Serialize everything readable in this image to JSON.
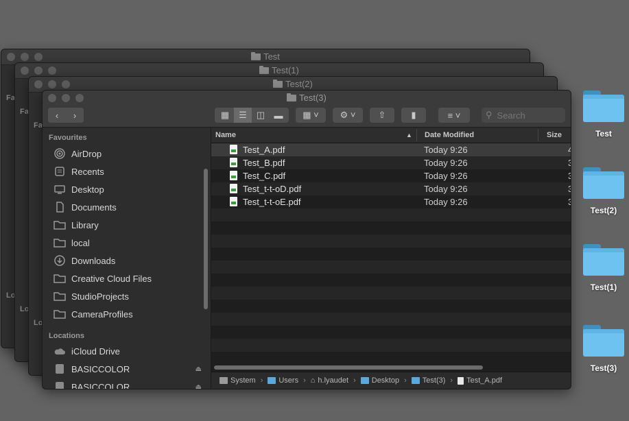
{
  "windows": [
    {
      "title": "Test"
    },
    {
      "title": "Test(1)"
    },
    {
      "title": "Test(2)"
    },
    {
      "title": "Test(3)"
    }
  ],
  "back_labels": {
    "favourites_short": "Fa",
    "locations_short": "Lo"
  },
  "toolbar": {
    "search_placeholder": "Search"
  },
  "sidebar": {
    "favourites_header": "Favourites",
    "favourites": [
      {
        "label": "AirDrop",
        "icon": "airdrop-icon"
      },
      {
        "label": "Recents",
        "icon": "recents-icon"
      },
      {
        "label": "Desktop",
        "icon": "desktop-icon"
      },
      {
        "label": "Documents",
        "icon": "documents-icon"
      },
      {
        "label": "Library",
        "icon": "folder-icon"
      },
      {
        "label": "local",
        "icon": "folder-icon"
      },
      {
        "label": "Downloads",
        "icon": "downloads-icon"
      },
      {
        "label": "Creative Cloud Files",
        "icon": "folder-icon"
      },
      {
        "label": "StudioProjects",
        "icon": "folder-icon"
      },
      {
        "label": "CameraProfiles",
        "icon": "folder-icon"
      }
    ],
    "locations_header": "Locations",
    "locations": [
      {
        "label": "iCloud Drive",
        "icon": "icloud-icon"
      },
      {
        "label": "BASICCOLOR",
        "icon": "disk-icon"
      },
      {
        "label": "BASICCOLOR",
        "icon": "disk-icon"
      }
    ]
  },
  "columns": {
    "name": "Name",
    "date": "Date Modified",
    "size": "Size"
  },
  "files": [
    {
      "name": "Test_A.pdf",
      "date": "Today 9:26",
      "size": "4"
    },
    {
      "name": "Test_B.pdf",
      "date": "Today 9:26",
      "size": "3"
    },
    {
      "name": "Test_C.pdf",
      "date": "Today 9:26",
      "size": "3"
    },
    {
      "name": "Test_t-t-oD.pdf",
      "date": "Today 9:26",
      "size": "3"
    },
    {
      "name": "Test_t-t-oE.pdf",
      "date": "Today 9:26",
      "size": "3"
    }
  ],
  "pathbar": [
    "System",
    "Users",
    "h.lyaudet",
    "Desktop",
    "Test(3)",
    "Test_A.pdf"
  ],
  "desktop_icons": [
    "Test",
    "Test(2)",
    "Test(1)",
    "Test(3)"
  ]
}
